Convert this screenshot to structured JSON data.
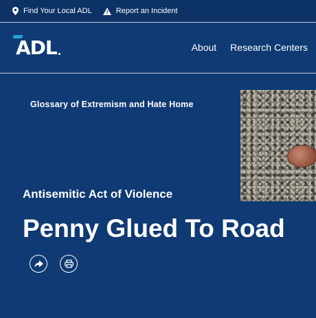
{
  "topbar": {
    "find_local": "Find Your Local ADL",
    "report": "Report an Incident"
  },
  "header": {
    "logo": "ADL",
    "nav": [
      "About",
      "Research Centers"
    ]
  },
  "breadcrumb": "Glossary of Extremism and Hate Home",
  "article": {
    "category": "Antisemitic Act of Violence",
    "title": "Penny Glued To Road"
  },
  "icons": {
    "location": "location-pin-icon",
    "warning": "warning-triangle-icon",
    "share": "share-icon",
    "print": "print-icon"
  },
  "colors": {
    "background": "#0f3a73",
    "topbar": "#0c3266",
    "logo_accent": "#2a9fd6"
  }
}
